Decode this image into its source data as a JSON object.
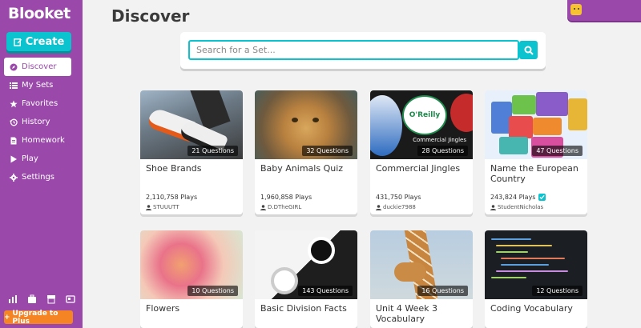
{
  "app": {
    "name": "Blooket"
  },
  "sidebar": {
    "create_label": "Create",
    "items": [
      {
        "label": "Discover",
        "icon": "compass-icon",
        "active": true
      },
      {
        "label": "My Sets",
        "icon": "list-icon"
      },
      {
        "label": "Favorites",
        "icon": "star-icon"
      },
      {
        "label": "History",
        "icon": "history-icon"
      },
      {
        "label": "Homework",
        "icon": "document-icon"
      },
      {
        "label": "Play",
        "icon": "play-icon"
      },
      {
        "label": "Settings",
        "icon": "gear-icon"
      }
    ],
    "bottom_icons": [
      "stats-icon",
      "briefcase-icon",
      "store-icon",
      "news-icon"
    ],
    "upgrade_label": "Upgrade to Plus"
  },
  "header": {
    "title": "Discover"
  },
  "search": {
    "placeholder": "Search for a Set..."
  },
  "colors": {
    "brand": "#9a49aa",
    "accent": "#0bc2cf",
    "upgrade": "#f48424"
  },
  "cards": [
    {
      "title": "Shoe Brands",
      "questions": "21 Questions",
      "plays": "2,110,758 Plays",
      "author": "STUUUTT",
      "verified": false
    },
    {
      "title": "Baby Animals Quiz",
      "questions": "32 Questions",
      "plays": "1,960,858 Plays",
      "author": "D.DTheGIRL",
      "verified": false
    },
    {
      "title": "Commercial Jingles",
      "questions": "28 Questions",
      "plays": "431,750 Plays",
      "author": "duckie7988",
      "verified": false,
      "thumb_caption": "Commercial Jingles",
      "thumb_logo": "O'Reilly"
    },
    {
      "title": "Name the European Country",
      "questions": "47 Questions",
      "plays": "243,824 Plays",
      "author": "StudentNicholas",
      "verified": true
    },
    {
      "title": "Flowers",
      "questions": "10 Questions"
    },
    {
      "title": "Basic Division Facts",
      "questions": "143 Questions"
    },
    {
      "title": "Unit 4 Week 3 Vocabulary",
      "questions": "16 Questions"
    },
    {
      "title": "Coding Vocabulary",
      "questions": "12 Questions"
    }
  ]
}
